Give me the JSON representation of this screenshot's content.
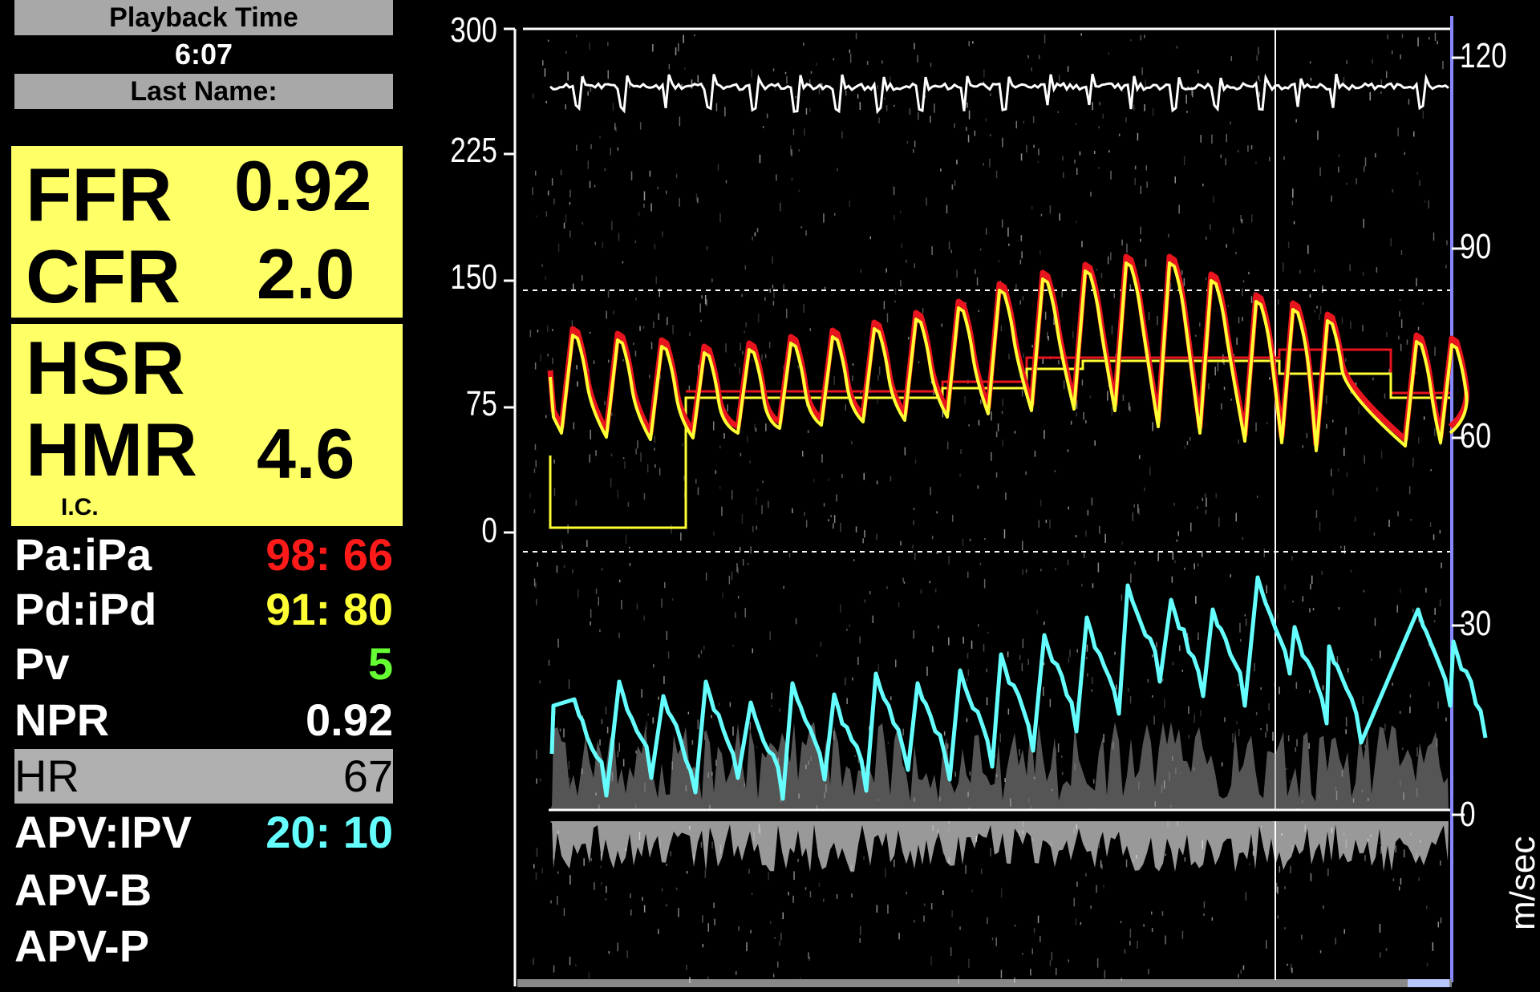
{
  "header": {
    "playback_label": "Playback Time",
    "playback_time": "6:07",
    "last_name_label": "Last Name:"
  },
  "indices": {
    "ffr_label": "FFR",
    "ffr_value": "0.92",
    "cfr_label": "CFR",
    "cfr_value": "2.0",
    "hsr_label": "HSR",
    "hsr_value": "",
    "hmr_label": "HMR",
    "hmr_value": "4.6",
    "ic_label": "I.C."
  },
  "measurements": [
    {
      "label": "Pa:iPa",
      "value": "98: 66",
      "color": "#ff1a1a"
    },
    {
      "label": "Pd:iPd",
      "value": "91: 80",
      "color": "#ffff33"
    },
    {
      "label": "Pv",
      "value": "5",
      "color": "#66ff33"
    },
    {
      "label": "NPR",
      "value": "0.92",
      "color": "#ffffff"
    },
    {
      "label": "HR",
      "value": "67",
      "color": "#000000"
    },
    {
      "label": "APV:IPV",
      "value": "20: 10",
      "color": "#66ffff"
    },
    {
      "label": "APV-B",
      "value": "",
      "color": "#ffffff"
    },
    {
      "label": "APV-P",
      "value": "",
      "color": "#ffffff"
    }
  ],
  "axes": {
    "pressure_ticks": [
      "300",
      "225",
      "150",
      "75",
      "0"
    ],
    "velocity_ticks": [
      "120",
      "90",
      "60",
      "30",
      "0"
    ],
    "velocity_unit": "m/sec"
  },
  "colors": {
    "aortic_pressure": "#e8141e",
    "distal_pressure": "#ffff33",
    "velocity": "#66ffff",
    "ecg": "#ffffff",
    "panel_bg": "#ffff66"
  }
}
